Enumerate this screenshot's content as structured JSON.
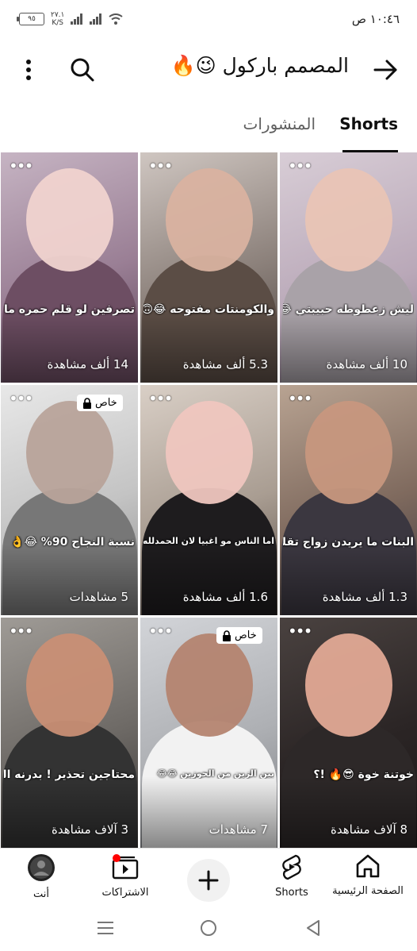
{
  "status": {
    "time": "١٠:٤٦ ص",
    "battery": "٩٥",
    "net_speed_value": "٢٧.١",
    "net_speed_unit": "K/S"
  },
  "header": {
    "title": "المصمم باركول 😉🔥"
  },
  "tabs": [
    {
      "label": "Shorts",
      "active": true
    },
    {
      "label": "المنشورات",
      "active": false
    }
  ],
  "videos": [
    {
      "views": "10 ألف مشاهدة",
      "caption": "ليش زعطوطه حبيبتي 😂😂",
      "private": false
    },
    {
      "views": "5.3 ألف مشاهدة",
      "caption": "والكومنتات مفتوحه 😂🙃",
      "private": false
    },
    {
      "views": "14 ألف مشاهدة",
      "caption": "تصرفين لو قلم حمره ما تشترين 😂😂",
      "private": false
    },
    {
      "views": "1.3 ألف مشاهدة",
      "caption": "البنات ما يريدن زواج تقليدي",
      "private": false
    },
    {
      "views": "1.6 ألف مشاهدة",
      "caption": "اما الناس مو اغبيا لان الحمدلله 😂😂",
      "private": false
    },
    {
      "views": "5 مشاهدات",
      "caption": "نسبة النجاح 90% 😂👌",
      "private": true,
      "private_label": "خاص"
    },
    {
      "views": "8 آلاف مشاهدة",
      "caption": "خوتنة خوة 😎🔥 !؟",
      "private": false
    },
    {
      "views": "7 مشاهدات",
      "caption": "بين الزين من الحوزين 😂😂",
      "private": true,
      "private_label": "خاص"
    },
    {
      "views": "3 آلاف مشاهدة",
      "caption": "محتاجين تحذير ! بدرنه الجاي !",
      "private": false
    }
  ],
  "bottom_nav": {
    "home": "الصفحة الرئيسية",
    "shorts": "Shorts",
    "subscriptions": "الاشتراكات",
    "you": "أنت"
  },
  "colors": {
    "accent_red": "#ff0000",
    "text_primary": "#0f0f0f",
    "text_secondary": "#606060"
  }
}
